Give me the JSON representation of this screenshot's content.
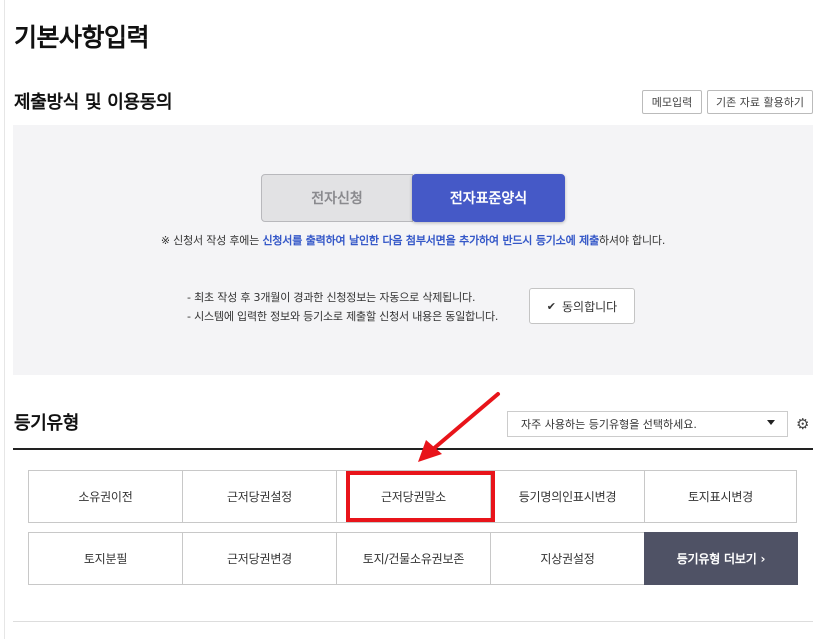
{
  "page": {
    "title": "기본사항입력"
  },
  "submission": {
    "title": "제출방식 및 이용동의",
    "memo_label": "메모입력",
    "reuse_label": "기존 자료 활용하기",
    "toggle": {
      "off_label": "전자신청",
      "on_label": "전자표준양식"
    },
    "notice": {
      "prefix": "※ 신청서 작성 후에는 ",
      "highlight": "신청서를 출력하여 날인한 다음 첨부서면을 추가하여 반드시 등기소에 제출",
      "suffix": "하셔야 합니다."
    },
    "bullets": [
      "- 최초 작성 후 3개월이 경과한 신청정보는 자동으로 삭제됩니다.",
      "- 시스템에 입력한 정보와 등기소로 제출할 신청서 내용은 동일합니다."
    ],
    "agree_label": "동의합니다"
  },
  "registration_type": {
    "title": "등기유형",
    "select_placeholder": "자주 사용하는 등기유형을 선택하세요.",
    "row1": [
      "소유권이전",
      "근저당권설정",
      "근저당권말소",
      "등기명의인표시변경",
      "토지표시변경"
    ],
    "row2": [
      "토지분필",
      "근저당권변경",
      "토지/건물소유권보존",
      "지상권설정",
      "등기유형 더보기 ›"
    ]
  },
  "colors": {
    "accent": "#4559c7",
    "more_button": "#4f5265",
    "annotation": "#e8141a",
    "notice_highlight": "#3558c8"
  },
  "icons": [
    "check-icon",
    "caret-down-icon",
    "gear-icon",
    "arrow-annotation"
  ]
}
